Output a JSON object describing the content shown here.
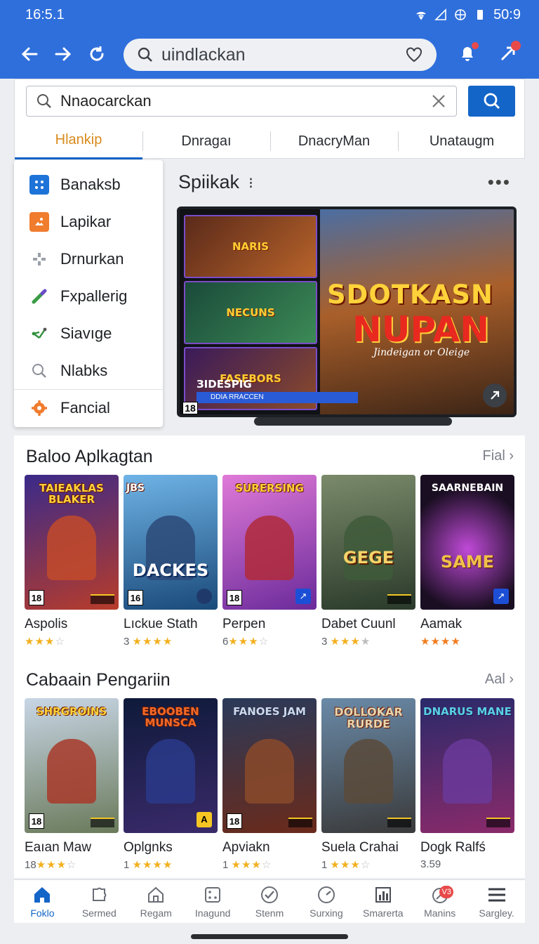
{
  "status_bar": {
    "time": "16:5.1",
    "clock_right": "50:9"
  },
  "browser": {
    "address_text": "uindlackan"
  },
  "search": {
    "value": "Nnaocarckan"
  },
  "tabs": [
    {
      "label": "Hlankip",
      "active": true
    },
    {
      "label": "Dnragaı",
      "active": false
    },
    {
      "label": "DnacryMan",
      "active": false
    },
    {
      "label": "Unataugm",
      "active": false
    }
  ],
  "side_menu": [
    {
      "label": "Banaksb",
      "icon": "grid-icon"
    },
    {
      "label": "Lapikar",
      "icon": "image-icon"
    },
    {
      "label": "Drnurkan",
      "icon": "gamepad-icon"
    },
    {
      "label": "Fxpallerig",
      "icon": "pencil-icon"
    },
    {
      "label": "Siavıge",
      "icon": "share-icon"
    },
    {
      "label": "Nlabks",
      "icon": "search-icon"
    },
    {
      "label": "Fancial",
      "icon": "gear-icon"
    }
  ],
  "feature": {
    "title": "Spiikak",
    "banner": {
      "headline1": "SDOTKASN",
      "headline2": "NUPAN",
      "tagline": "Jindeigan or Oleige",
      "strip_title": "ЗIDESPIG",
      "strip_sub": "DDIA  RRACCEN",
      "age": "18",
      "mini_titles": [
        "NARIS",
        "NECUNS",
        "FASEBORS"
      ]
    }
  },
  "sections": [
    {
      "title": "Baloo Aplkagtan",
      "link": "Fial",
      "cards": [
        {
          "name": "Aspolis",
          "count": "",
          "stars": "★★★",
          "empty": "☆",
          "age": "18",
          "cover_title": "TAIEAKLAS BLAKER",
          "cover_big": ""
        },
        {
          "name": "Lıckue Stath",
          "count": "3",
          "stars": "★★★★",
          "empty": "",
          "age": "16",
          "cover_title": "JBS",
          "cover_big": "DACKES"
        },
        {
          "name": "Perpen",
          "count": "6",
          "stars": "★★★",
          "empty": "☆",
          "age": "18",
          "cover_title": "SURERSING",
          "cover_big": ""
        },
        {
          "name": "Dabet Cuunl",
          "count": "3",
          "stars": "★★★",
          "empty": "★",
          "age": "",
          "cover_title": "",
          "cover_big": "GEGE"
        },
        {
          "name": "Aamak",
          "count": "",
          "stars": "★★★★",
          "empty": "",
          "age": "",
          "cover_title": "SAARNEBAIN",
          "cover_big": "SAME"
        }
      ]
    },
    {
      "title": "Cabaain Pengariin",
      "link": "Aal",
      "cards": [
        {
          "name": "Eaıan Maw",
          "count": "18",
          "stars": "★★★",
          "empty": "☆",
          "age": "18",
          "cover_title": "SHRGROINS",
          "cover_big": ""
        },
        {
          "name": "Oplgnks",
          "count": "1",
          "stars": "★★★★",
          "empty": "",
          "age": "",
          "cover_title": "EBOOBEN MUNSCA",
          "cover_big": ""
        },
        {
          "name": "Apviakn",
          "count": "1",
          "stars": "★★★",
          "empty": "☆",
          "age": "18",
          "cover_title": "FANOES JAM",
          "cover_big": ""
        },
        {
          "name": "Suela Crahai",
          "count": "1",
          "stars": "★★★",
          "empty": "☆",
          "age": "",
          "cover_title": "DOLLOKAR RURDE",
          "cover_big": ""
        },
        {
          "name": "Dogk Ralfś",
          "count": "3.59",
          "stars": "",
          "empty": "",
          "age": "",
          "cover_title": "DNARUS MANE",
          "cover_big": ""
        }
      ]
    }
  ],
  "bottom_nav": [
    {
      "label": "Foklo",
      "icon": "home-icon",
      "active": true
    },
    {
      "label": "Sermed",
      "icon": "puzzle-icon",
      "active": false
    },
    {
      "label": "Regam",
      "icon": "house-outline-icon",
      "active": false
    },
    {
      "label": "Inagund",
      "icon": "dice-icon",
      "active": false
    },
    {
      "label": "Stenm",
      "icon": "check-shield-icon",
      "active": false
    },
    {
      "label": "Surxing",
      "icon": "gauge-icon",
      "active": false
    },
    {
      "label": "Smarerta",
      "icon": "chart-icon",
      "active": false
    },
    {
      "label": "Manins",
      "icon": "tag-icon",
      "active": false,
      "badge": "V3"
    },
    {
      "label": "Sargley.",
      "icon": "menu-icon",
      "active": false
    }
  ],
  "colors": {
    "primary": "#2f6fdc",
    "accent": "#1465c8",
    "tab_active_text": "#d98a1c",
    "star": "#f2b01e",
    "badge": "#e84a4a"
  }
}
